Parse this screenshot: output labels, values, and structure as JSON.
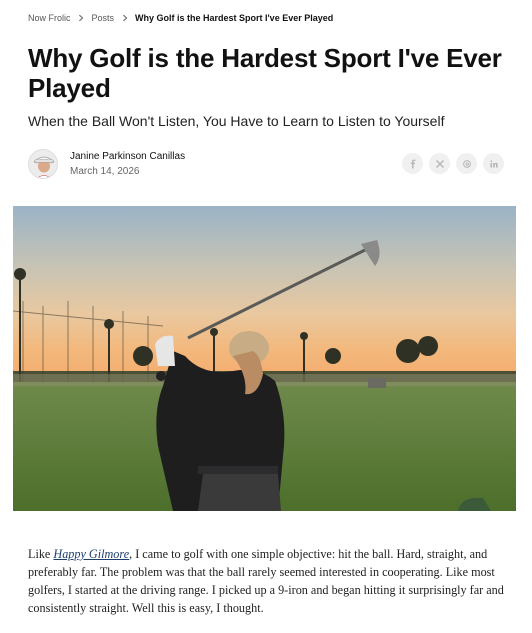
{
  "breadcrumb": {
    "items": [
      "Now Frolic",
      "Posts"
    ],
    "current": "Why Golf is the Hardest Sport I've Ever Played"
  },
  "article": {
    "title": "Why Golf is the Hardest Sport I've Ever Played",
    "subtitle": "When the Ball Won't Listen, You Have to Learn to Listen to Yourself",
    "author": "Janine Parkinson Canillas",
    "date": "March 14, 2026",
    "share_icons": [
      "facebook-icon",
      "x-icon",
      "threads-icon",
      "linkedin-icon"
    ],
    "body": {
      "intro": "Like ",
      "link_text": "Happy Gilmore",
      "rest": ", I came to golf with one simple objective: hit the ball. Hard, straight, and preferably far. The problem was that the ball rarely seemed interested in cooperating. Like most golfers, I started at the driving range. I picked up a 9-iron and began hitting it surprisingly far and consistently straight. Well this is easy, I thought."
    }
  },
  "colors": {
    "link": "#1c3f6e",
    "share_bg": "#f0f0f0",
    "share_icon": "#b5b5b5"
  }
}
